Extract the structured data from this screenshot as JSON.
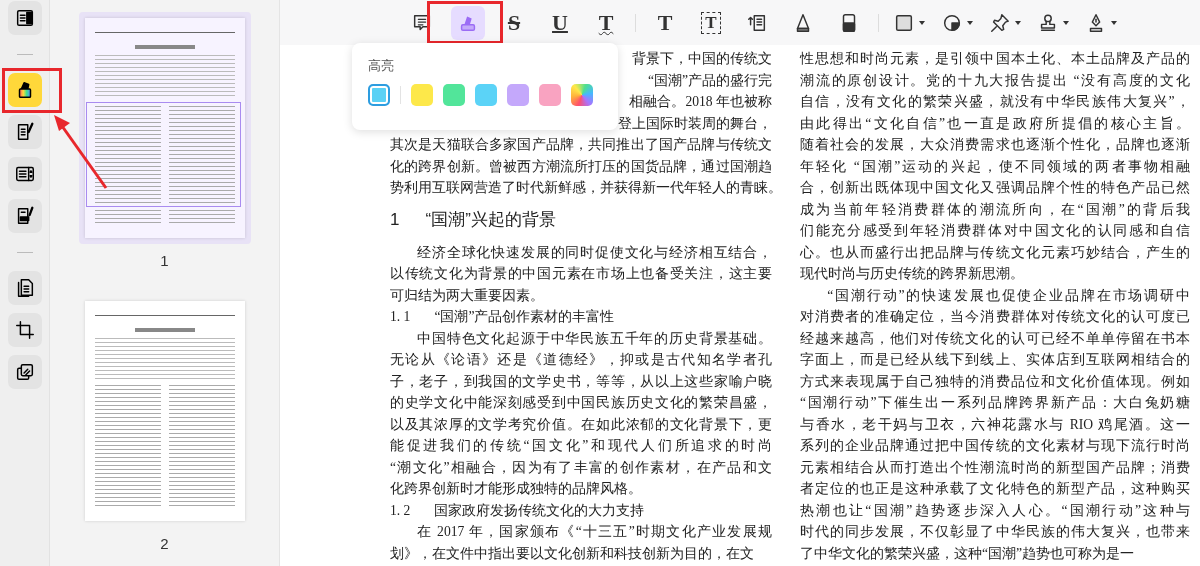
{
  "sidebar": {
    "tools": [
      {
        "kind": "tool",
        "selected": false
      },
      {
        "kind": "separator"
      },
      {
        "kind": "tool",
        "selected": true
      },
      {
        "kind": "tool",
        "selected": false
      },
      {
        "kind": "tool",
        "selected": false
      },
      {
        "kind": "tool",
        "selected": false
      },
      {
        "kind": "separator"
      },
      {
        "kind": "tool",
        "selected": false
      },
      {
        "kind": "tool",
        "selected": false
      },
      {
        "kind": "tool",
        "selected": false
      }
    ]
  },
  "thumbnails": [
    {
      "label": "1",
      "selected": true
    },
    {
      "label": "2",
      "selected": false
    }
  ],
  "toolbar": {
    "tools": [
      {
        "kind": "icon",
        "selected": false
      },
      {
        "kind": "icon",
        "selected": true
      },
      {
        "kind": "strike",
        "glyph": "S",
        "selected": false
      },
      {
        "kind": "underline",
        "glyph": "U",
        "selected": false
      },
      {
        "kind": "squiggly",
        "glyph": "T",
        "selected": false
      },
      {
        "kind": "separator"
      },
      {
        "kind": "text",
        "glyph": "T",
        "selected": false
      },
      {
        "kind": "textbox",
        "glyph": "T",
        "selected": false
      },
      {
        "kind": "icon",
        "selected": false
      },
      {
        "kind": "icon",
        "selected": false
      },
      {
        "kind": "icon",
        "selected": false
      },
      {
        "kind": "separator"
      },
      {
        "kind": "icon",
        "selected": false,
        "dropdown": true
      },
      {
        "kind": "icon",
        "selected": false,
        "dropdown": true
      },
      {
        "kind": "icon",
        "selected": false,
        "dropdown": true
      },
      {
        "kind": "icon",
        "selected": false,
        "dropdown": true
      },
      {
        "kind": "icon",
        "selected": false,
        "dropdown": true
      }
    ]
  },
  "highlight_popup": {
    "title": "高亮",
    "current": {
      "color": "#5ad1f5"
    },
    "swatches": [
      {
        "kind": "solid",
        "color": "#fde84a"
      },
      {
        "kind": "solid",
        "color": "#52e59a"
      },
      {
        "kind": "solid",
        "color": "#5bd3f7"
      },
      {
        "kind": "solid",
        "color": "#c4a8fb"
      },
      {
        "kind": "solid",
        "color": "#f9a3c1"
      },
      {
        "kind": "gradient"
      }
    ]
  },
  "document": {
    "left_column": [
      {
        "kind": "fragment",
        "text": "背景下，中国的传统文"
      },
      {
        "kind": "fragment",
        "text": "“国潮”产品的盛行完"
      },
      {
        "kind": "fragment",
        "text": "相融合。2018 年也被称"
      },
      {
        "kind": "fragment",
        "text": "登上国际时装周的舞台，"
      },
      {
        "kind": "continuation",
        "lines": [
          "其次是天猫联合多家国产品牌，共同推出了国产品牌与传统文",
          "化的跨界创新。曾被西方潮流所打压的国货品牌，通过国潮趋",
          "势利用互联网营造了时代新鲜感，并获得新一代年轻人的青睐。"
        ]
      },
      {
        "kind": "heading",
        "number": "1",
        "text": "“国潮”兴起的背景"
      },
      {
        "kind": "paragraph",
        "lines": [
          "经济全球化快速发展的同时促使文化与经济相互结合，",
          "以传统文化为背景的中国元素在市场上也备受关注，这主要",
          "可归结为两大重要因素。"
        ]
      },
      {
        "kind": "subheading",
        "number": "1. 1",
        "text": "“国潮”产品创作素材的丰富性"
      },
      {
        "kind": "paragraph",
        "lines": [
          "中国特色文化起源于中华民族五千年的历史背景基础。",
          "无论从《论语》还是《道德经》，抑或是古代知名学者孔",
          "子，老子，到我国的文学史书，等等，从以上这些家喻户晓",
          "的史学文化中能深刻感受到中国民族历史文化的繁荣昌盛，",
          "以及其浓厚的文学考究价值。在如此浓郁的文化背景下，更",
          "能促进我们的传统“国文化”和现代人们所追求的时尚",
          "“潮文化”相融合，因为有了丰富的创作素材，在产品和文",
          "化跨界创新时才能形成独特的品牌风格。"
        ]
      },
      {
        "kind": "subheading",
        "number": "1. 2",
        "text": "国家政府发扬传统文化的大力支持"
      },
      {
        "kind": "paragraph",
        "lines": [
          "在 2017 年，国家颁布《“十三五”时期文化产业发展规",
          "划》，在文件中指出要以文化创新和科技创新为目的，在文"
        ]
      }
    ],
    "right_column": [
      {
        "kind": "continuation",
        "lines": [
          "性思想和时尚元素，是引领中国本土化、本土品牌及产品的",
          "潮流的原创设计。党的十九大报告提出 “没有高度的文化",
          "自信，没有文化的繁荣兴盛，就没有中华民族伟大复兴”，",
          "由此得出“文化自信”也一直是政府所提倡的核心主旨。",
          "随着社会的发展，大众消费需求也逐渐个性化，品牌也逐渐",
          "年轻化 “国潮”运动的兴起，使不同领域的两者事物相融",
          "合，创新出既体现中国文化又强调品牌个性的特色产品已然",
          "成为当前年轻消费群体的潮流所向，在“国潮”的背后我",
          "们能充分感受到年轻消费群体对中国文化的认同感和自信",
          "心。也从而盛行出把品牌与传统文化元素巧妙结合，产生的",
          "现代时尚与历史传统的跨界新思潮。"
        ]
      },
      {
        "kind": "paragraph",
        "lines": [
          "“国潮行动”的快速发展也促使企业品牌在市场调研中",
          "对消费者的准确定位，当今消费群体对传统文化的认可度已",
          "经越来越高，他们对传统文化的认可已经不单单停留在书本",
          "字面上，而是已经从线下到线上、实体店到互联网相结合的",
          "方式来表现属于自己独特的消费品位和文化价值体现。例如",
          "“国潮行动”下催生出一系列品牌跨界新产品：大白兔奶糖",
          "与香水，老干妈与卫衣，六神花露水与 RIO 鸡尾酒。这一",
          "系列的企业品牌通过把中国传统的文化素材与现下流行时尚",
          "元素相结合从而打造出个性潮流时尚的新型国产品牌；消费",
          "者定位的也正是这种承载了文化特色的新型产品，这种购买",
          "热潮也让“国潮”趋势逐步深入人心。“国潮行动”这种与",
          "时代的同步发展，不仅彰显了中华民族的伟大复兴，也带来",
          "了中华文化的繁荣兴盛，这种“国潮”趋势也可称为是一"
        ]
      }
    ]
  }
}
